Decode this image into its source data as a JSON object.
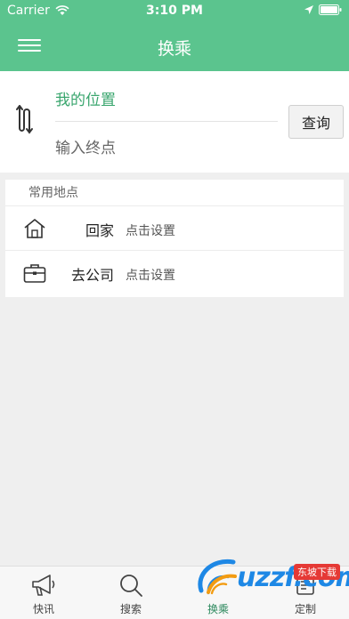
{
  "status_bar": {
    "carrier": "Carrier",
    "time": "3:10 PM"
  },
  "header": {
    "title": "换乘",
    "menu_icon": "hamburger-menu-icon"
  },
  "route": {
    "from_text": "我的位置",
    "to_placeholder": "输入终点",
    "query_label": "查询",
    "swap_icon": "swap-route-icon"
  },
  "places": {
    "header": "常用地点",
    "items": [
      {
        "icon": "home-icon",
        "name": "回家",
        "hint": "点击设置"
      },
      {
        "icon": "briefcase-icon",
        "name": "去公司",
        "hint": "点击设置"
      }
    ]
  },
  "tabs": [
    {
      "label": "快讯",
      "icon": "megaphone-icon"
    },
    {
      "label": "搜索",
      "icon": "search-icon"
    },
    {
      "label": "换乘",
      "icon": "transfer-icon",
      "active": true
    },
    {
      "label": "定制",
      "icon": "customize-icon"
    }
  ],
  "watermark": {
    "text": "uzzf.com",
    "tag": "东坡下载"
  },
  "colors": {
    "accent": "#5bc48e",
    "from_text": "#3aa66e"
  }
}
